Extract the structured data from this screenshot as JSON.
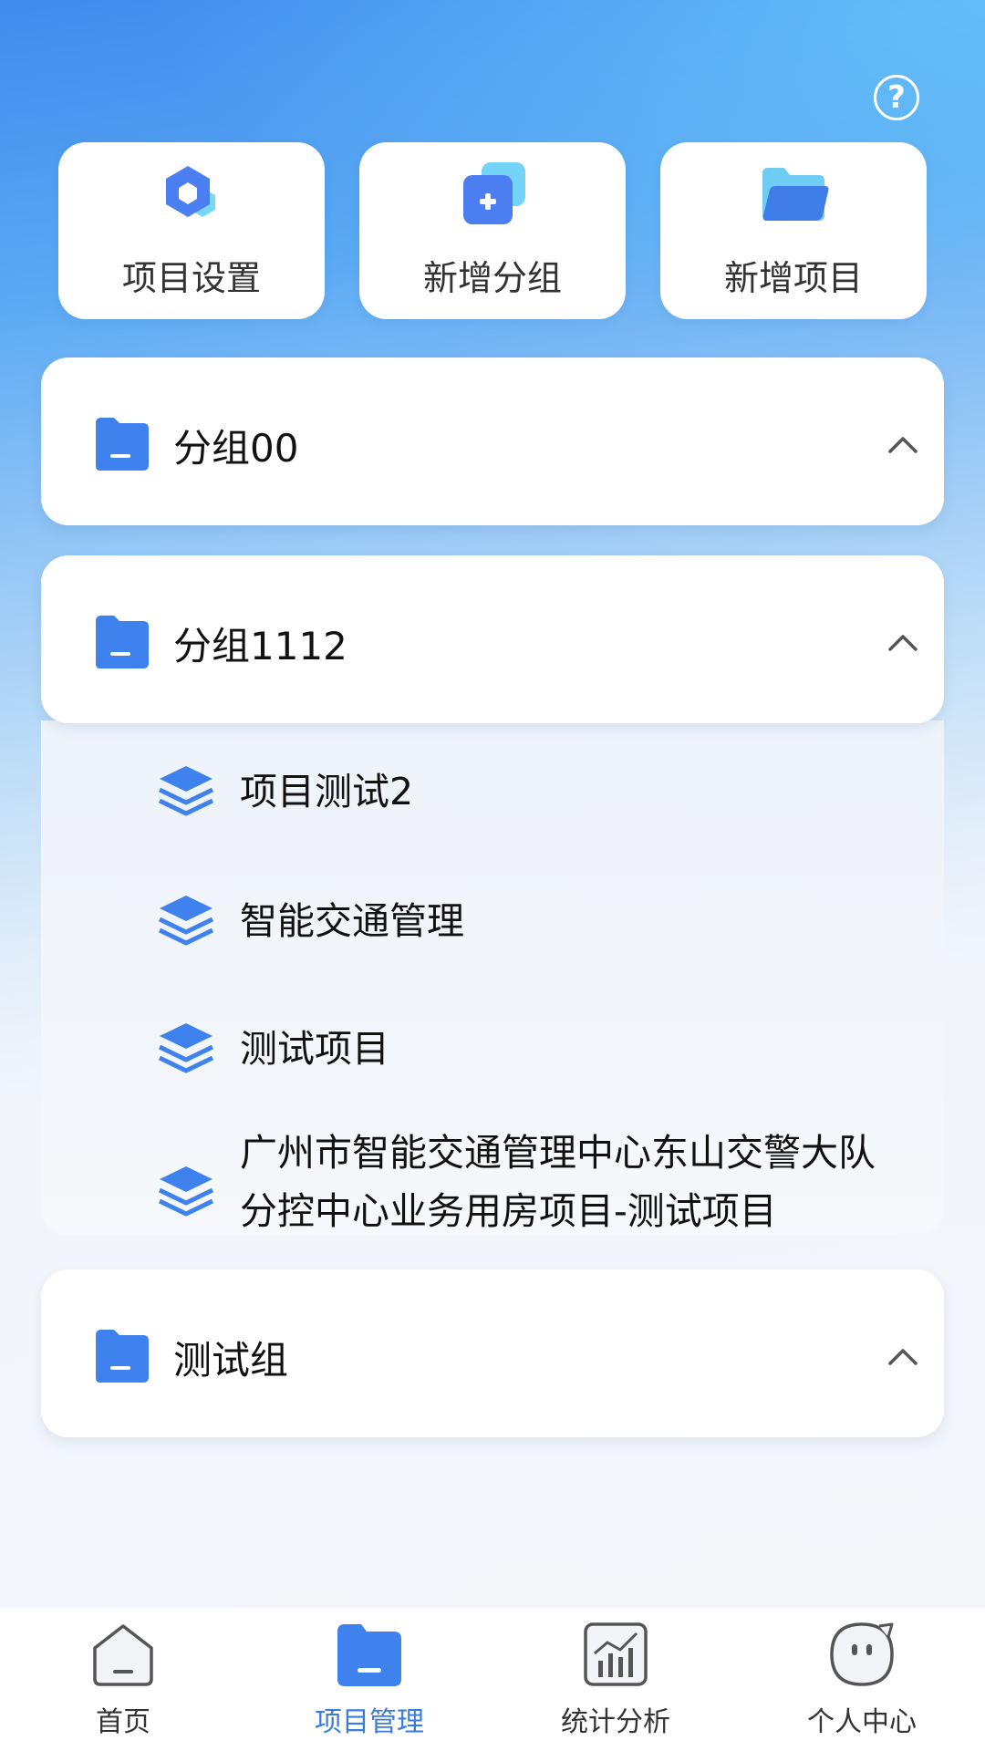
{
  "quick_actions": [
    {
      "label": "项目设置",
      "icon": "hexagon-settings-icon"
    },
    {
      "label": "新增分组",
      "icon": "add-group-icon"
    },
    {
      "label": "新增项目",
      "icon": "folder-add-icon"
    }
  ],
  "groups": [
    {
      "name": "分组00",
      "expanded": false
    },
    {
      "name": "分组1112",
      "expanded": true,
      "projects": [
        "项目测试2",
        "智能交通管理",
        "测试项目",
        "广州市智能交通管理中心东山交警大队分控中心业务用房项目-测试项目"
      ]
    },
    {
      "name": "测试组",
      "expanded": false
    }
  ],
  "tabs": [
    {
      "label": "首页",
      "icon": "home-icon",
      "active": false
    },
    {
      "label": "项目管理",
      "icon": "folder-icon",
      "active": true
    },
    {
      "label": "统计分析",
      "icon": "chart-icon",
      "active": false
    },
    {
      "label": "个人中心",
      "icon": "chat-face-icon",
      "active": false
    }
  ],
  "colors": {
    "accent": "#3a7be0",
    "icon_blue": "#3f82ee",
    "inactive": "#333333"
  }
}
